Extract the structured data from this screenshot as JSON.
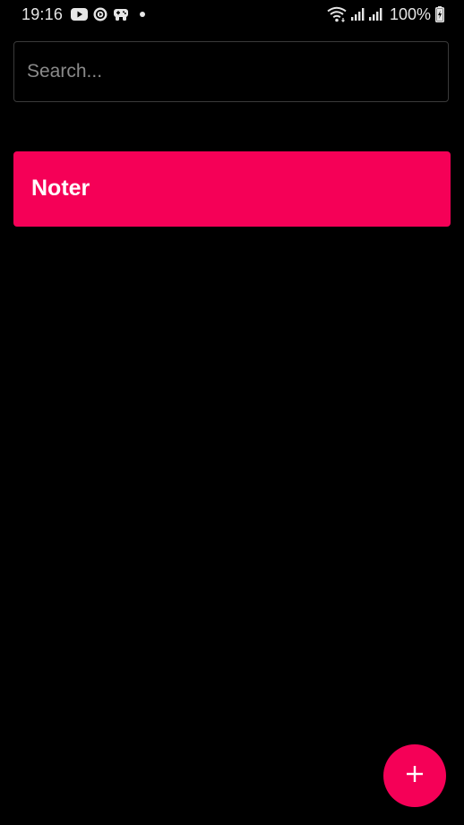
{
  "status_bar": {
    "time": "19:16",
    "left_icons": [
      "youtube-icon",
      "cast-icon",
      "game-controller-icon",
      "dot-icon"
    ],
    "right_icons": [
      "wifi-icon",
      "signal-icon",
      "signal-icon",
      "battery-charging-icon"
    ],
    "battery": "100%"
  },
  "search": {
    "placeholder": "Search...",
    "value": ""
  },
  "notes": [
    {
      "title": "Noter"
    }
  ],
  "fab": {
    "icon": "plus-icon"
  },
  "colors": {
    "background": "#000000",
    "accent": "#f50057",
    "search_border": "#3a3a3a",
    "placeholder": "#8a8a8a"
  }
}
